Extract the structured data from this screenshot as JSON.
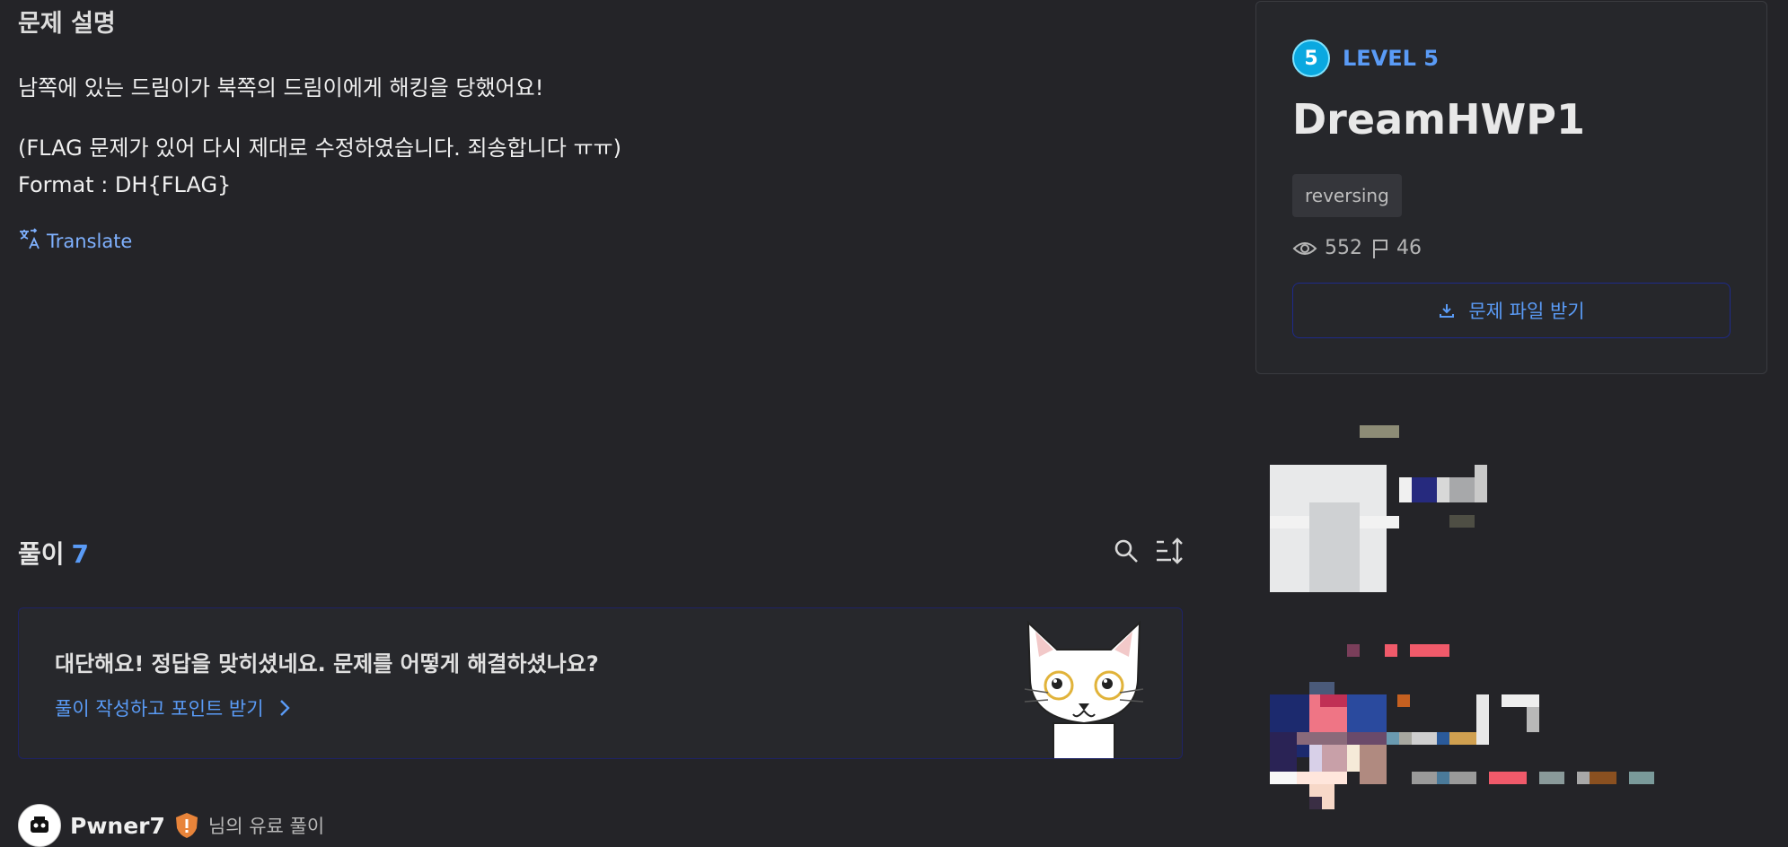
{
  "description": {
    "heading": "문제 설명",
    "line1": "남쪽에 있는 드림이가 북쪽의 드림이에게 해킹을 당했어요!",
    "line2": "(FLAG 문제가 있어 다시 제대로 수정하였습니다. 죄송합니다 ㅠㅠ)",
    "line3": "Format : DH{FLAG}",
    "translate_label": "Translate"
  },
  "solutions": {
    "heading": "풀이",
    "count": "7",
    "search_icon": "search-icon",
    "sort_icon": "sort-icon"
  },
  "promo": {
    "title": "대단해요! 정답을 맞히셨네요. 문제를 어떻게 해결하셨나요?",
    "link_label": "풀이 작성하고 포인트 받기",
    "mascot": "cat-mascot"
  },
  "author": {
    "name": "Pwner7",
    "suffix": "님의 유료 풀이"
  },
  "challenge": {
    "level_number": "5",
    "level_label": "LEVEL 5",
    "title": "DreamHWP1",
    "tag": "reversing",
    "views": "552",
    "solves": "46",
    "download_label": "문제 파일 받기"
  },
  "colors": {
    "background": "#242428",
    "accent": "#5a9bf6",
    "level_badge": "#0aa8e0"
  }
}
